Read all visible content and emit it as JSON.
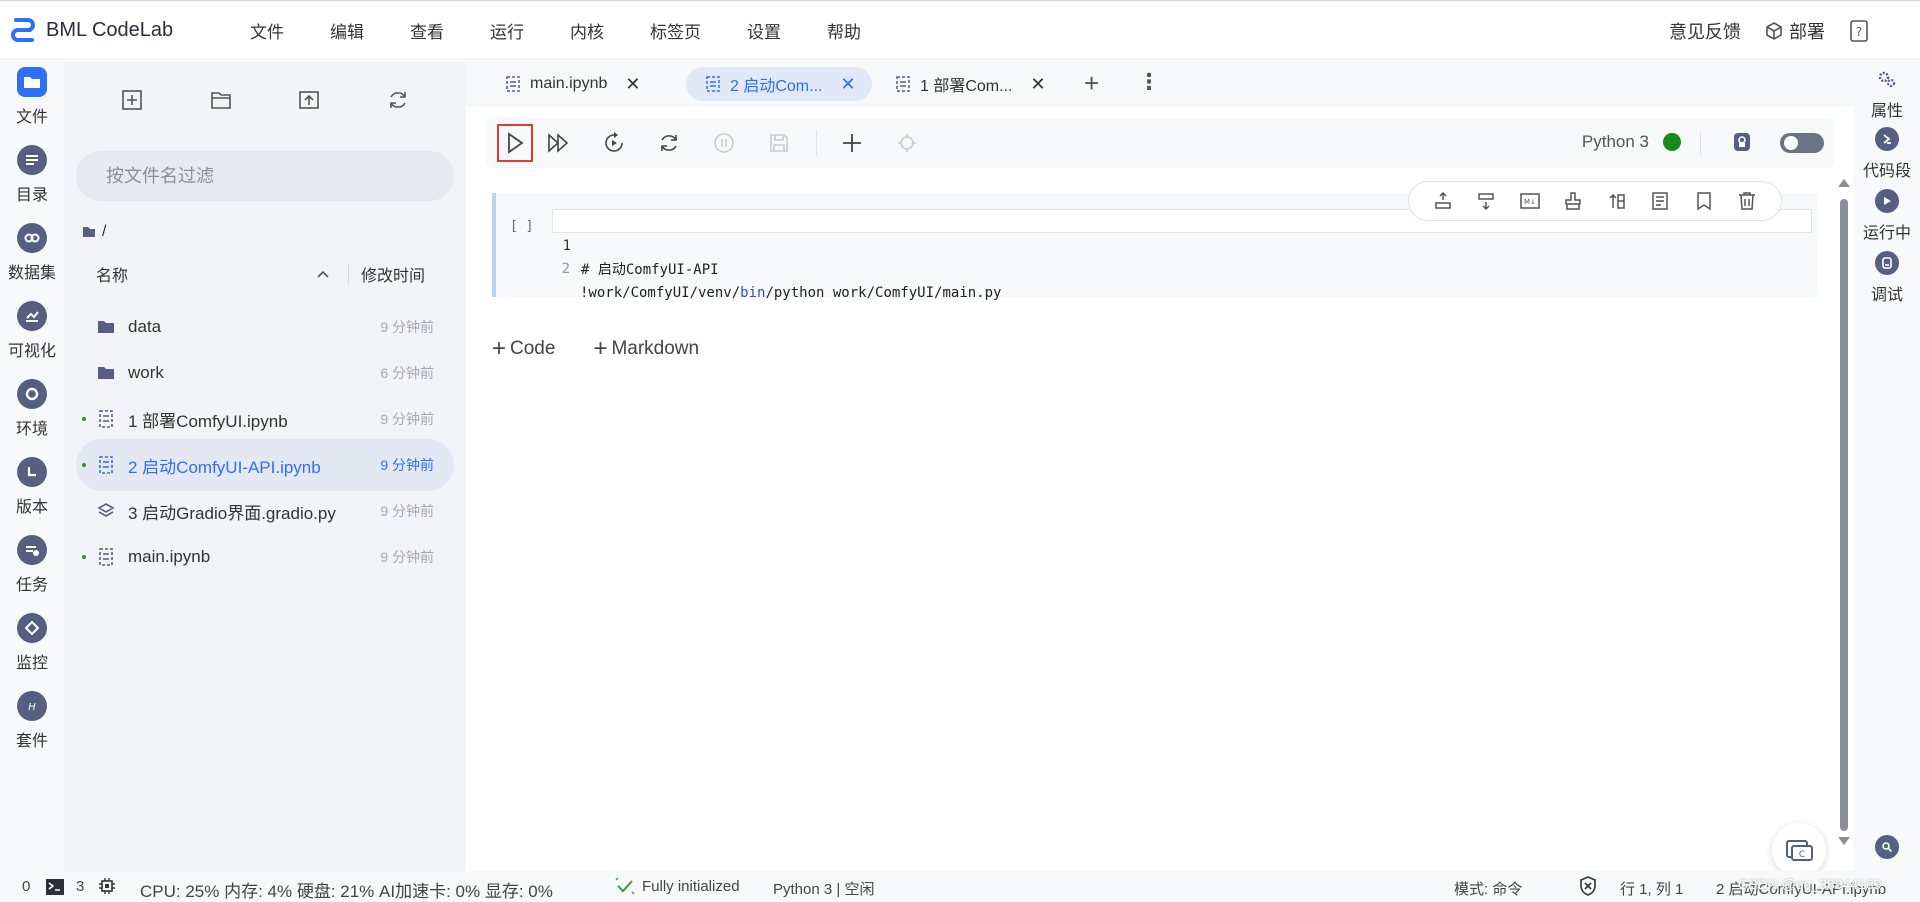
{
  "app": {
    "name": "BML CodeLab"
  },
  "menu": [
    "文件",
    "编辑",
    "查看",
    "运行",
    "内核",
    "标签页",
    "设置",
    "帮助"
  ],
  "top_right": {
    "feedback": "意见反馈",
    "deploy": "部署"
  },
  "activity": [
    {
      "label": "文件",
      "icon": "folder-icon"
    },
    {
      "label": "目录",
      "icon": "list-icon"
    },
    {
      "label": "数据集",
      "icon": "dataset-icon"
    },
    {
      "label": "可视化",
      "icon": "chart-icon"
    },
    {
      "label": "环境",
      "icon": "environment-icon"
    },
    {
      "label": "版本",
      "icon": "version-icon"
    },
    {
      "label": "任务",
      "icon": "task-icon"
    },
    {
      "label": "监控",
      "icon": "monitor-icon"
    },
    {
      "label": "套件",
      "icon": "suite-icon"
    }
  ],
  "file_panel": {
    "filter_placeholder": "按文件名过滤",
    "path": "/",
    "col_name": "名称",
    "col_modified": "修改时间",
    "files": [
      {
        "name": "data",
        "time": "9 分钟前",
        "type": "folder",
        "running": false,
        "selected": false
      },
      {
        "name": "work",
        "time": "6 分钟前",
        "type": "folder",
        "running": false,
        "selected": false
      },
      {
        "name": "1 部署ComfyUI.ipynb",
        "time": "9 分钟前",
        "type": "notebook",
        "running": true,
        "selected": false
      },
      {
        "name": "2 启动ComfyUI-API.ipynb",
        "time": "9 分钟前",
        "type": "notebook",
        "running": true,
        "selected": true
      },
      {
        "name": "3 启动Gradio界面.gradio.py",
        "time": "9 分钟前",
        "type": "gradio",
        "running": false,
        "selected": false
      },
      {
        "name": "main.ipynb",
        "time": "9 分钟前",
        "type": "notebook",
        "running": true,
        "selected": false
      }
    ]
  },
  "tabs": [
    {
      "label": "main.ipynb",
      "active": false
    },
    {
      "label": "2 启动Com...",
      "active": true
    },
    {
      "label": "1 部署Com...",
      "active": false
    }
  ],
  "notebook": {
    "kernel": "Python 3",
    "kernel_status_color": "#1a8a1a",
    "prompt": "[ ]",
    "lines": [
      {
        "n": "1",
        "comment": "# 启动ComfyUI-API"
      },
      {
        "n": "2",
        "pre": "!work/ComfyUI/venv/",
        "kw": "bin",
        "post": "/python work/ComfyUI/main.py"
      }
    ],
    "add_code": "Code",
    "add_markdown": "Markdown"
  },
  "right_panel": [
    {
      "label": "属性",
      "icon": "gears-icon"
    },
    {
      "label": "代码段",
      "icon": "snippet-icon"
    },
    {
      "label": "运行中",
      "icon": "running-icon"
    },
    {
      "label": "调试",
      "icon": "debug-icon"
    }
  ],
  "status": {
    "count0": "0",
    "count3": "3",
    "resources": "CPU:  25% 内存:  4% 硬盘:  21% AI加速卡:  0% 显存:  0%",
    "init": "Fully initialized",
    "kernel_state": "Python 3 | 空闲",
    "mode": "模式: 命令",
    "position": "行 1, 列 1",
    "filename": "2 启动ComfyUI-API.ipynb",
    "watermark": "CSDN @qq_38944169"
  },
  "colors": {
    "accent": "#2f6ff5",
    "run_highlight": "#e53935"
  }
}
